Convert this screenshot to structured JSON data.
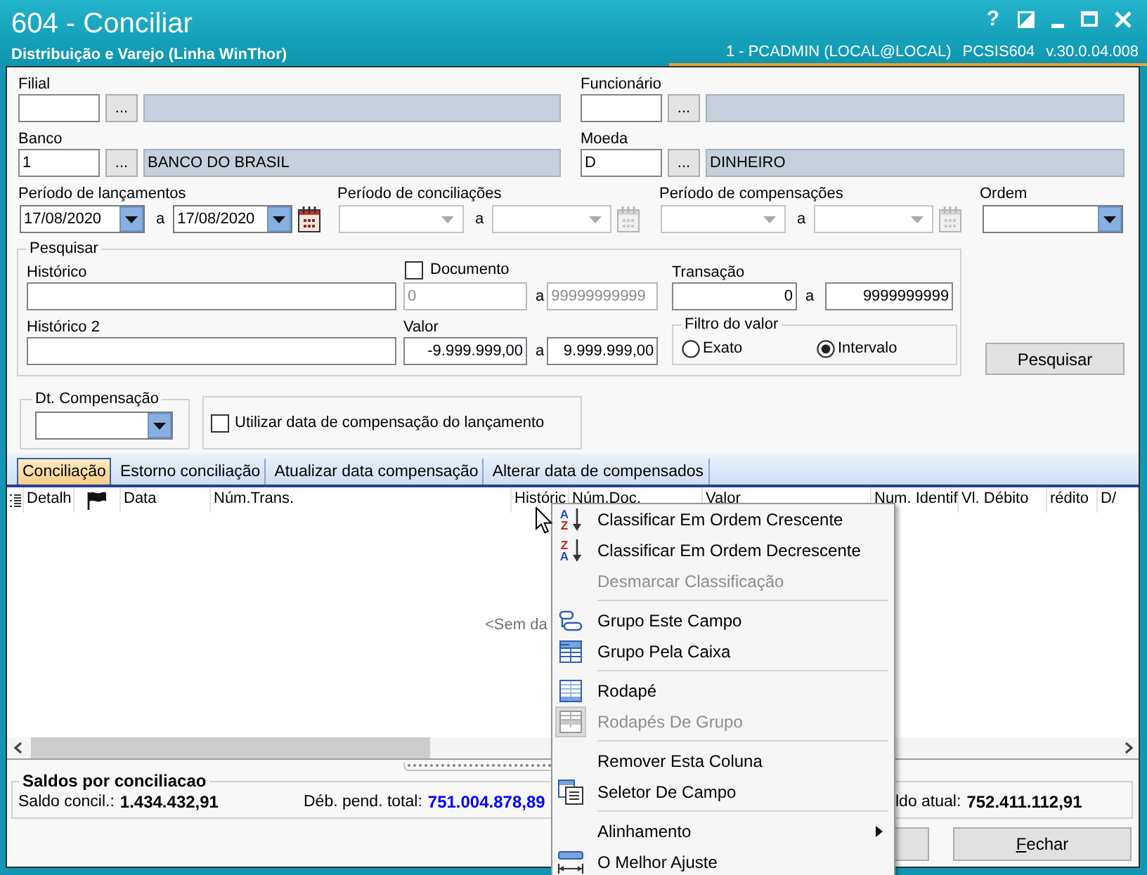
{
  "window": {
    "title": "604 - Conciliar",
    "subtitle": "Distribuição e Varejo (Linha WinThor)",
    "session": "1 - PCADMIN (LOCAL@LOCAL)",
    "program": "PCSIS604",
    "version": "v.30.0.04.008",
    "controls": [
      {
        "kind": "help",
        "label": "?"
      },
      {
        "kind": "theme"
      },
      {
        "kind": "minimize"
      },
      {
        "kind": "maximize"
      },
      {
        "kind": "close"
      }
    ]
  },
  "lookups": [
    {
      "label": "Filial",
      "button": "..."
    },
    {
      "label": "Funcionário",
      "button": "..."
    },
    {
      "label": "Banco",
      "code": "1",
      "button": "...",
      "description": "BANCO DO BRASIL"
    },
    {
      "label": "Moeda",
      "code": "D",
      "button": "...",
      "description": "DINHEIRO"
    }
  ],
  "periods": [
    {
      "label": "Período de lançamentos",
      "from": "17/08/2020",
      "separator": "a",
      "to": "17/08/2020",
      "disabled": false
    },
    {
      "label": "Período de conciliações",
      "separator": "a",
      "disabled": true
    },
    {
      "label": "Período de compensações",
      "separator": "a",
      "disabled": true
    }
  ],
  "order": {
    "label": "Ordem"
  },
  "search": {
    "title": "Pesquisar",
    "history": {
      "label": "Histórico"
    },
    "document": {
      "label": "Documento",
      "checked": false,
      "from": "0",
      "separator": "a",
      "to": "99999999999"
    },
    "transaction": {
      "label": "Transação",
      "from": "0",
      "separator": "a",
      "to": "9999999999"
    },
    "history_2": {
      "label": "Histórico 2"
    },
    "value": {
      "label": "Valor",
      "from": "-9.999.999,00",
      "separator": "a",
      "to": "9.999.999,00"
    },
    "value_filter": {
      "title": "Filtro do valor",
      "options": [
        {
          "label": "Exato",
          "selected": false
        },
        {
          "label": "Intervalo",
          "selected": true
        }
      ]
    },
    "button": "Pesquisar"
  },
  "compensation_date": {
    "title": "Dt. Compensação"
  },
  "use_compensation_date": {
    "label": "Utilizar data de compensação do lançamento",
    "checked": false
  },
  "tabs": [
    {
      "label": "Conciliação",
      "selected": true
    },
    {
      "label": "Estorno conciliação",
      "selected": false
    },
    {
      "label": "Atualizar data compensação",
      "selected": false
    },
    {
      "label": "Alterar data de compensados",
      "selected": false
    }
  ],
  "grid": {
    "columns": [
      {
        "kind": "list-icon"
      },
      {
        "kind": "text",
        "label": "Detalh"
      },
      {
        "kind": "flag"
      },
      {
        "kind": "text",
        "label": "Data"
      },
      {
        "kind": "text",
        "label": "Núm.Trans."
      },
      {
        "kind": "text",
        "label": "Históric"
      },
      {
        "kind": "text",
        "label": "Núm.Doc."
      },
      {
        "kind": "text",
        "label": "Valor"
      },
      {
        "kind": "text",
        "label": "Num. Identif"
      },
      {
        "kind": "text",
        "label": "Vl. Débito"
      },
      {
        "kind": "text",
        "label": "rédito"
      },
      {
        "kind": "text",
        "label": "D/"
      }
    ],
    "empty_text": "<Sem da"
  },
  "summary": {
    "title": "Saldos por conciliacao",
    "items": [
      {
        "label": "Saldo concil.:",
        "value": "1.434.432,91",
        "color": "#000000"
      },
      {
        "label": "Déb. pend. total:",
        "value": "751.004.878,89",
        "color": "#0000ff"
      },
      {
        "label": "ldo atual:",
        "value": "752.411.112,91",
        "color": "#000000"
      }
    ]
  },
  "buttons": [
    {
      "kind": "blank"
    },
    {
      "kind": "text",
      "label": "Fechar",
      "mnemonic_underlined": true
    }
  ],
  "context_menu": {
    "items": [
      {
        "kind": "sort-asc",
        "glyphs": [
          "A",
          "Z"
        ],
        "label": "Classificar Em Ordem Crescente",
        "disabled": false,
        "checked": false
      },
      {
        "kind": "sort-desc",
        "glyphs": [
          "Z",
          "A"
        ],
        "label": "Classificar Em Ordem Decrescente",
        "disabled": false,
        "checked": false
      },
      {
        "kind": "plain",
        "label": "Desmarcar Classificação",
        "disabled": true,
        "checked": false
      },
      {
        "kind": "separator"
      },
      {
        "kind": "group-field",
        "label": "Grupo Este Campo",
        "disabled": false,
        "checked": false
      },
      {
        "kind": "group-box",
        "label": "Grupo Pela Caixa",
        "disabled": false,
        "checked": false
      },
      {
        "kind": "separator"
      },
      {
        "kind": "footer",
        "label": "Rodapé",
        "disabled": false,
        "checked": false
      },
      {
        "kind": "group-footer",
        "label": "Rodapés De Grupo",
        "disabled": true,
        "checked": true
      },
      {
        "kind": "separator"
      },
      {
        "kind": "plain",
        "label": "Remover Esta Coluna",
        "disabled": false,
        "checked": false
      },
      {
        "kind": "field-chooser",
        "label": "Seletor De Campo",
        "disabled": false,
        "checked": false
      },
      {
        "kind": "separator"
      },
      {
        "kind": "submenu",
        "label": "Alinhamento",
        "disabled": false,
        "checked": false
      },
      {
        "kind": "best-fit",
        "label": "O Melhor Ajuste",
        "disabled": false,
        "checked": false
      }
    ]
  }
}
